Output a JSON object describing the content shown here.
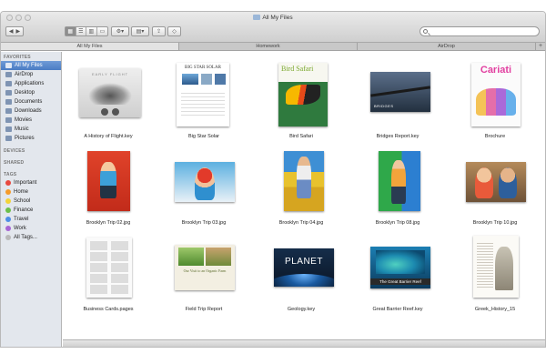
{
  "window": {
    "title": "All My Files"
  },
  "toolbar": {
    "view_modes": [
      "icon-view",
      "list-view",
      "column-view",
      "cover-flow-view"
    ],
    "search_placeholder": ""
  },
  "tabs": [
    {
      "label": "All My Files",
      "active": true
    },
    {
      "label": "Homework",
      "active": false
    },
    {
      "label": "AirDrop",
      "active": false
    }
  ],
  "sidebar": {
    "favorites_header": "FAVORITES",
    "favorites": [
      {
        "label": "All My Files",
        "icon": "all-files-icon",
        "selected": true
      },
      {
        "label": "AirDrop",
        "icon": "airdrop-icon",
        "selected": false
      },
      {
        "label": "Applications",
        "icon": "applications-icon",
        "selected": false
      },
      {
        "label": "Desktop",
        "icon": "desktop-icon",
        "selected": false
      },
      {
        "label": "Documents",
        "icon": "documents-icon",
        "selected": false
      },
      {
        "label": "Downloads",
        "icon": "downloads-icon",
        "selected": false
      },
      {
        "label": "Movies",
        "icon": "movies-icon",
        "selected": false
      },
      {
        "label": "Music",
        "icon": "music-icon",
        "selected": false
      },
      {
        "label": "Pictures",
        "icon": "pictures-icon",
        "selected": false
      }
    ],
    "devices_header": "DEVICES",
    "shared_header": "SHARED",
    "tags_header": "TAGS",
    "tags": [
      {
        "label": "Important",
        "color": "#e8493f"
      },
      {
        "label": "Home",
        "color": "#f59b2b"
      },
      {
        "label": "School",
        "color": "#f3d33a"
      },
      {
        "label": "Finance",
        "color": "#6cc04a"
      },
      {
        "label": "Travel",
        "color": "#4f8ee6"
      },
      {
        "label": "Work",
        "color": "#a766d4"
      },
      {
        "label": "All Tags...",
        "color": "#b9b9b9"
      }
    ]
  },
  "files": [
    {
      "name": "A History of Flight.key",
      "thumb_title": "EARLY FLIGHT"
    },
    {
      "name": "Big Star Solar",
      "thumb_title": "BIG STAR SOLAR"
    },
    {
      "name": "Bird Safari",
      "thumb_title": "Bird Safari"
    },
    {
      "name": "Bridges Report.key",
      "thumb_title": "BRIDGES"
    },
    {
      "name": "Brochure",
      "thumb_title": "Cariati"
    },
    {
      "name": "Brooklyn Trip 02.jpg",
      "thumb_title": ""
    },
    {
      "name": "Brooklyn Trip 03.jpg",
      "thumb_title": ""
    },
    {
      "name": "Brooklyn Trip 04.jpg",
      "thumb_title": ""
    },
    {
      "name": "Brooklyn Trip 08.jpg",
      "thumb_title": ""
    },
    {
      "name": "Brooklyn Trip 10.jpg",
      "thumb_title": ""
    },
    {
      "name": "Business Cards.pages",
      "thumb_title": ""
    },
    {
      "name": "Field Trip Report",
      "thumb_title": "Our Visit to an Organic Farm"
    },
    {
      "name": "Geology.key",
      "thumb_title": "PLANET"
    },
    {
      "name": "Great Barrier Reef.key",
      "thumb_title": "The Great Barrier Reef"
    },
    {
      "name": "Greek_History_15",
      "thumb_title": ""
    }
  ]
}
